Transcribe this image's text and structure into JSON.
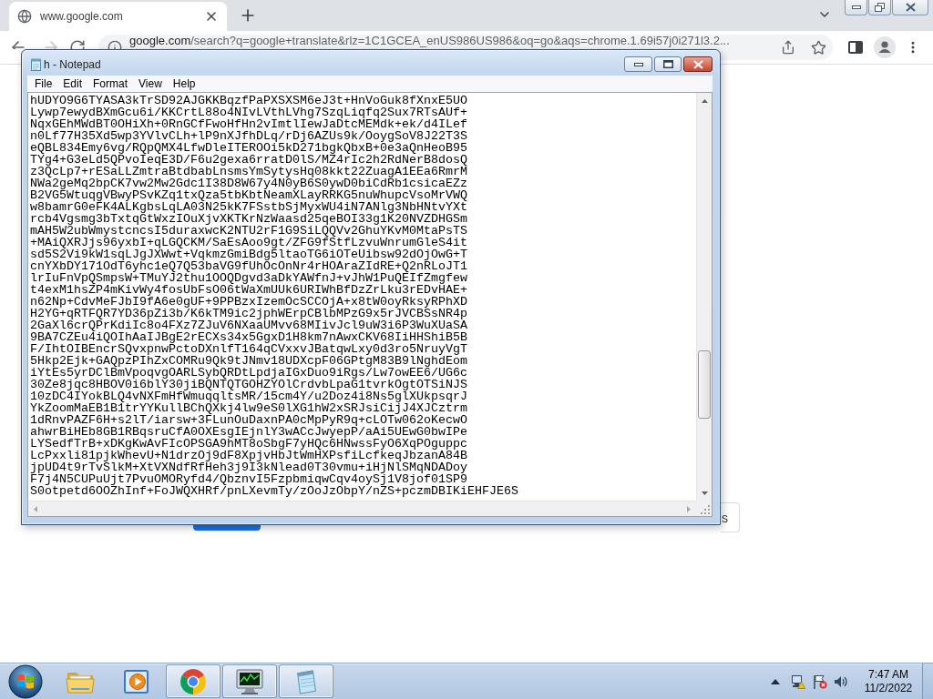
{
  "browser": {
    "tabs": [
      {
        "title": "www.google.com",
        "selected": true
      }
    ],
    "navigation": {
      "back_disabled": false,
      "forward_disabled": true
    },
    "address_bar": {
      "host": "google.com",
      "path": "/search?q=google+translate&rlz=1C1GCEA_enUS986US986&oq=go&aqs=chrome.1.69i57j0i271l3.2..."
    }
  },
  "page": {
    "buttons": [
      {
        "kind": "primary"
      },
      {
        "kind": "secondary",
        "label": "s"
      }
    ]
  },
  "notepad": {
    "title": "h - Notepad",
    "menu": [
      "File",
      "Edit",
      "Format",
      "View",
      "Help"
    ],
    "lines": [
      "hUDYO9G6TYASA3kTrSD92AJGKKBqzfPaPXSXSM6eJ3t+HnVoGuk8fXnxE5UO",
      "Lywp7ewydBXmGcu6i/KKCrtL88o4NIvLVthLVhg7SzqLiqfq2Sux7RTsAUf+",
      "NqxGEhMWdBT0OHiXh+0RnGCfFwoHfHn2vImtlIewJaDtcMEMdk+ek/d4ILef",
      "n0Lf77H35Xd5wp3YVlvCLh+lP9nXJfhDLq/rDj6AZUs9k/OoygSoV8J22T3S",
      "eQBL834Emy6vg/RQpQMX4LfwDleITEROOi5kD271bgkQbxB+0e3aQnHeoB95",
      "TYg4+G3eLd5QPvoIeqE3D/F6u2gexa6rratD0lS/MZ4rIc2h2RdNerB8dosQ",
      "z3QcLp7+rESaLLZmtraBtdbabLnsmsYmSytysHq08kkt22ZuagA1EEa6RmrM",
      "NWa2geMq2bpCK7vw2Mw2Gdc1I38D8W67y4N0yB6S0ywD0biCdRb1csicaEZz",
      "B2VG5WtuqgVBwyPSvKZq1txQza5tbKbtNeamXLayRRKG5nuWhupcVsoMrVWQ",
      "w8bamrG0eFK4ALKgbsLqLA03N25kK7FSstbSjMyxWU4iN7ANlg3NbHNtvYXt",
      "rcb4Vgsmg3bTxtqGtWxzIOuXjvXKTKrNzWaasd25qeBOI33g1K20NVZDHGSm",
      "mAH5W2ubWmystcncsI5duraxwcK2NTU2rF1G9SiLQQVv2GhuYKvM0MtaPsTS",
      "+MAiQXRJjs96yxbI+qLGQCKM/SaEsAoo9gt/ZFG9fStfLzvuWnrumGleS4it",
      "sd5S2Vi9kW1sqLJgJXWwt+VqkmzGmiBdg5ltaoTG6iOTeUibsw92dOjOwG+T",
      "cnYXbDY171OdT6yhc1eQ7Q53baVG9fUhOcOnNr4rHOAraZIdRE+Q2nRLoJT1",
      "lrIuFnVpQSmpsW+TMuYJ2thu1OOQDgvd3aDkYAWfnJ+vJhW1PuQEIfZmgfew",
      "t4exM1hsZP4mKivWy4fosUbFsO06tWaXmUUk6URIWhBfDzZrLku3rEDvHAE+",
      "n62Np+CdvMeFJbI9fA6e0gUF+9PPBzxIzemOcSCCOjA+x8tW0oyRksyRPhXD",
      "H2YG+qRTFQR7YD36pZi3b/K6kTM9ic2jphWErpCBlbMPzG9x5rJVCBSsNR4p",
      "2GaXl6crQPrKdiIc8o4FXz7ZJuV6NXaaUMvv68MIivJcl9uW3i6P3WuXUaSA",
      "9BA7CZEu4iQOIhAaIJBgE2rECXs34x5GgxD1H8km7nAwxCKV68IiHHShiB5B",
      "F/IhtOIBEncrSQvxpnwPctoDXnlfT164qCVxxvJBatqwLxy0d3ro5NruyVgT",
      "5Hkp2Ejk+GAQpzPIhZxCOMRu9Qk9tJNmv18UDXcpF06GPtgM83B9lNghdEom",
      "iYtEs5yrDClBmVpoqvgOARLSybQRDtLpdjaIGxDuo9iRgs/Lw7owEE6/UG6c",
      "30Ze8jqc8HBOV0i6blY30jiBQNTQTGOHZYOlCrdvbLpaG1tvrkOgtOTSiNJS",
      "10zDC4IYokBLQ4vNXFmHfWmuqqltsMR/15cm4Y/u2Doz4i8Ns5glXUkpsqrJ",
      "YkZoomMaEB1B1trYYKullBChQXkj4lw9eS0lXG1hW2xSRJsiCijJ4XJCztrm",
      "1dRnvPAZF6H+s2lT/iarsw+3FLunOuDaxnPA0cMpPyR9q+cLOTw062oKecwO",
      "ahwrBiHEb8GB1RBqsruCfA0OXEsgIEjnlY3wACcJwyepP/aAi5UEwG0bwIPe",
      "LYSedfTrB+xDKgKwAvFIcOPSGA9hMT8oSbgF7yHQc6HNwssFyO6XqPOguppc",
      "LcPxxli81pjkWhevU+N1drzOj9dF8XpjvHbJtWmHXPsfiLcfkeqJbzanA84B",
      "jpUD4t9rTvSlkM+XtVXNdfRfHeh3j9I3kNlead0T30vmu+iHjNlSMqNDADoy",
      "F7j4N5CUPuUjt7PvuOMORyfd4/QbznvI5FzpbmiqwCqv4oySj1V8jof01SP9",
      "S0otpetd6OOZhInf+FoJWQXHRf/pnLXevmTy/zOoJzObpY/nZS+pczmDBIKiEHFJE6S"
    ]
  },
  "taskbar": {
    "apps": [
      {
        "kind": "explorer",
        "open": false
      },
      {
        "kind": "media-player",
        "open": false
      },
      {
        "kind": "chrome",
        "open": true
      },
      {
        "kind": "task-manager",
        "open": true
      },
      {
        "kind": "notepad",
        "open": true
      }
    ],
    "clock": {
      "time": "7:47 AM",
      "date": "11/2/2022"
    }
  }
}
